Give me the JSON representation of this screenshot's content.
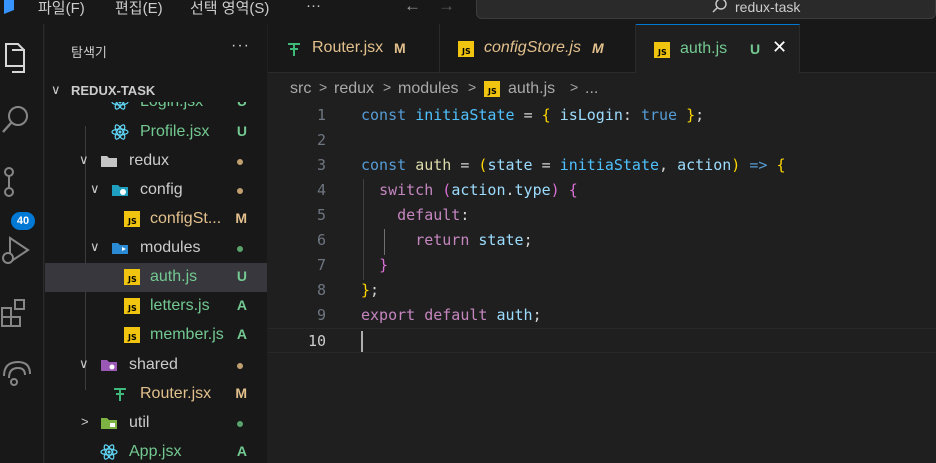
{
  "menu": {
    "file": "파일(F)",
    "edit": "편집(E)",
    "selection": "선택 영역(S)",
    "more": "···"
  },
  "command_center": {
    "label": "redux-task",
    "icon": "search-icon"
  },
  "activity_bar": {
    "items": [
      "explorer-icon",
      "search-icon",
      "source-control-icon",
      "run-debug-icon",
      "extensions-icon",
      "remote-explorer-icon"
    ],
    "scm_badge": "40"
  },
  "explorer": {
    "title": "탐색기",
    "more": "···",
    "section": "REDUX-TASK",
    "tree": [
      {
        "label": "Login.jsx",
        "status": "U",
        "icon": "react-icon"
      },
      {
        "label": "Profile.jsx",
        "status": "U",
        "icon": "react-icon"
      },
      {
        "label": "redux",
        "status": "dot",
        "icon": "folder-icon"
      },
      {
        "label": "config",
        "status": "dot",
        "icon": "config-folder-icon"
      },
      {
        "label": "configSt...",
        "status": "M",
        "icon": "js-icon"
      },
      {
        "label": "modules",
        "status": "dot",
        "icon": "modules-folder-icon"
      },
      {
        "label": "auth.js",
        "status": "U",
        "icon": "js-icon"
      },
      {
        "label": "letters.js",
        "status": "A",
        "icon": "js-icon"
      },
      {
        "label": "member.js",
        "status": "A",
        "icon": "js-icon"
      },
      {
        "label": "shared",
        "status": "dot",
        "icon": "shared-folder-icon"
      },
      {
        "label": "Router.jsx",
        "status": "M",
        "icon": "router-icon"
      },
      {
        "label": "util",
        "status": "dot",
        "icon": "util-folder-icon"
      },
      {
        "label": "App.jsx",
        "status": "A",
        "icon": "react-icon"
      }
    ]
  },
  "tabs": [
    {
      "name": "Router.jsx",
      "status": "M",
      "icon": "router-icon",
      "italic": false
    },
    {
      "name": "configStore.js",
      "status": "M",
      "icon": "js-icon",
      "italic": true
    },
    {
      "name": "auth.js",
      "status": "U",
      "icon": "js-icon",
      "italic": false,
      "active": true,
      "close": "✕"
    }
  ],
  "breadcrumb": {
    "src": "src",
    "redux": "redux",
    "modules": "modules",
    "file": "auth.js",
    "rest": "..."
  },
  "editor": {
    "line_numbers": [
      "1",
      "2",
      "3",
      "4",
      "5",
      "6",
      "7",
      "8",
      "9",
      "10"
    ],
    "current_line": "10",
    "code": [
      "const initiaState = { isLogin: true };",
      "",
      "const auth = (state = initiaState, action) => {",
      "  switch (action.type) {",
      "    default:",
      "      return state;",
      "  }",
      "};",
      "export default auth;",
      ""
    ]
  },
  "colors": {
    "untracked": "#73c991",
    "modified": "#e2c08d",
    "accent": "#0078d4",
    "js_badge": "#f1c40f",
    "react": "#61dafb"
  }
}
